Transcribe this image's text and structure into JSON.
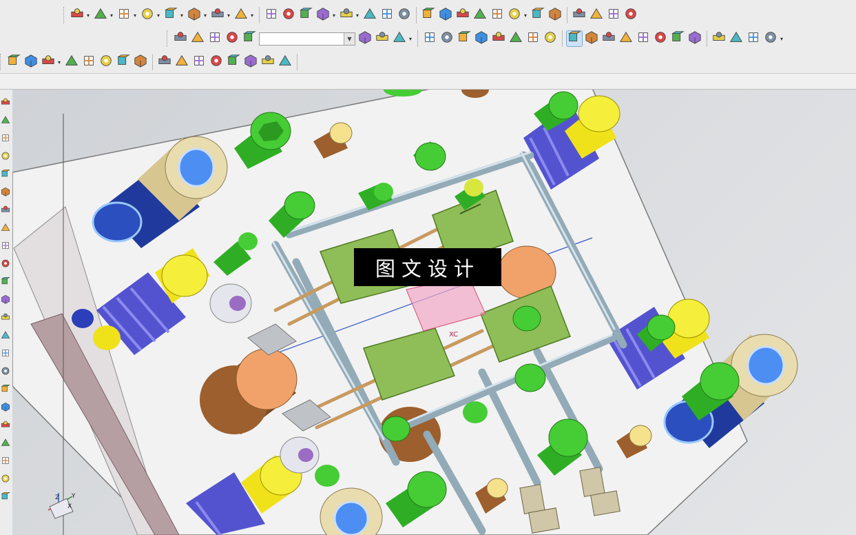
{
  "app": {
    "name": "3D CAD modeling application",
    "colors": {
      "toolbar_bg": "#ececec",
      "viewport_bg": "#d9dbde",
      "mold_plate": "#f4f4f4",
      "cooling_pipe": "#b9c9d4",
      "slider_block": "#8cba54",
      "bolt_head": "#3dbf2f",
      "spring": "#6261d6",
      "guide_pin": "#f2e51a",
      "bushing": "#d9c58f",
      "ejector_core": "#f1a26a"
    }
  },
  "toolbars": {
    "row1": [
      {
        "icon": "assembly-move-icon",
        "dropdown": true
      },
      {
        "icon": "component-edit-icon",
        "dropdown": true
      },
      {
        "icon": "component-delete-icon",
        "dropdown": true
      },
      {
        "icon": "component-copy-icon",
        "dropdown": true
      },
      {
        "icon": "component-pattern-icon",
        "dropdown": true
      },
      {
        "icon": "wave-link-icon",
        "dropdown": true
      },
      {
        "icon": "replace-component-icon",
        "dropdown": true
      },
      {
        "icon": "reference-set-icon",
        "dropdown": true
      },
      {
        "icon": "sketch-triangle-icon",
        "dropdown": false
      },
      {
        "icon": "table-grid-icon",
        "dropdown": false
      },
      {
        "icon": "datum-point-icon",
        "dropdown": false
      },
      {
        "icon": "gear-set-icon",
        "dropdown": true
      },
      {
        "icon": "rectangle-sketch-icon",
        "dropdown": true
      },
      {
        "icon": "extrude-block-icon",
        "dropdown": false
      },
      {
        "icon": "revolve-icon",
        "dropdown": false
      },
      {
        "icon": "box-icon",
        "dropdown": false
      },
      {
        "icon": "plate-icon",
        "dropdown": false
      },
      {
        "icon": "edge-blend-icon",
        "dropdown": false
      },
      {
        "icon": "measure-icon",
        "dropdown": false
      },
      {
        "icon": "waffle-plate-icon",
        "dropdown": false
      },
      {
        "icon": "connect-nodes-icon",
        "dropdown": false
      },
      {
        "icon": "teal-point-icon",
        "dropdown": true
      },
      {
        "icon": "cylinder-icon",
        "dropdown": false
      },
      {
        "icon": "prism-icon",
        "dropdown": false
      },
      {
        "icon": "orange-solid-icon",
        "dropdown": false
      },
      {
        "icon": "sheet-icon",
        "dropdown": false
      },
      {
        "icon": "cube-icon",
        "dropdown": false
      },
      {
        "icon": "multi-cube-icon",
        "dropdown": false
      }
    ],
    "row2": [
      {
        "icon": "mold-insert-icon",
        "dropdown": false
      },
      {
        "icon": "mold-slide-icon",
        "dropdown": false
      },
      {
        "icon": "pocket-icon",
        "dropdown": false
      },
      {
        "icon": "bottle-icon",
        "dropdown": false
      },
      {
        "icon": "trim-tool-icon",
        "dropdown": false
      },
      {
        "icon": "feature-box-icon",
        "dropdown": false
      },
      {
        "icon": "feature-cube-icon",
        "dropdown": false
      },
      {
        "icon": "curve-tool-icon",
        "dropdown": true
      },
      {
        "icon": "mold-wizard-initialize-icon",
        "dropdown": false
      },
      {
        "icon": "mold-csys-icon",
        "dropdown": false
      },
      {
        "icon": "shrinkage-icon",
        "dropdown": false
      },
      {
        "icon": "workpiece-icon",
        "dropdown": false
      },
      {
        "icon": "cavity-layout-icon",
        "dropdown": false
      },
      {
        "icon": "family-mold-icon",
        "dropdown": false
      },
      {
        "icon": "injection-gate-icon",
        "dropdown": false
      },
      {
        "icon": "runner-icon",
        "dropdown": false
      },
      {
        "icon": "mold-tools-icon",
        "dropdown": false,
        "selected": true
      },
      {
        "icon": "parting-icon",
        "dropdown": false
      },
      {
        "icon": "moldbase-icon",
        "dropdown": false
      },
      {
        "icon": "standard-part-icon",
        "dropdown": false
      },
      {
        "icon": "ejector-pin-icon",
        "dropdown": false
      },
      {
        "icon": "slider-lifter-icon",
        "dropdown": false
      },
      {
        "icon": "sub-insert-icon",
        "dropdown": false
      },
      {
        "icon": "cooling-icon",
        "dropdown": false
      },
      {
        "icon": "electrode-icon",
        "dropdown": false
      },
      {
        "icon": "trim-mold-icon",
        "dropdown": false
      },
      {
        "icon": "pocket-mold-icon",
        "dropdown": false
      },
      {
        "icon": "bom-icon",
        "dropdown": true
      }
    ],
    "row2_select_value": "",
    "row3": [
      {
        "icon": "snap-arrow-icon",
        "dropdown": false
      },
      {
        "icon": "snap-point-icon",
        "dropdown": false
      },
      {
        "icon": "filter-rect-icon",
        "dropdown": true
      },
      {
        "icon": "shaded-icon",
        "dropdown": false
      },
      {
        "icon": "shaded-edges-icon",
        "dropdown": false
      },
      {
        "icon": "end-point-icon",
        "dropdown": false
      },
      {
        "icon": "mid-point-icon",
        "dropdown": false
      },
      {
        "icon": "control-point-icon",
        "dropdown": false
      },
      {
        "icon": "intersection-icon",
        "dropdown": false
      },
      {
        "icon": "arc-center-icon",
        "dropdown": false
      },
      {
        "icon": "quadrant-icon",
        "dropdown": false
      },
      {
        "icon": "circle-point-icon",
        "dropdown": false
      },
      {
        "icon": "plus-point-icon",
        "dropdown": false
      },
      {
        "icon": "point-on-curve-icon",
        "dropdown": false
      },
      {
        "icon": "point-on-face-icon",
        "dropdown": false
      },
      {
        "icon": "snap-grid-icon",
        "dropdown": false
      }
    ]
  },
  "viewport": {
    "watermark": "图文设计",
    "csys_labels": [
      "Z",
      "Y",
      "X"
    ],
    "datum_label": "XC"
  },
  "resource_bar": [
    "part-navigator-icon",
    "assembly-navigator-icon",
    "constraint-icon",
    "history-icon",
    "reuse-library-icon",
    "roles-icon",
    "web-browser-icon",
    "palette-icon",
    "system-materials-icon",
    "process-studio-icon",
    "check-mate-icon",
    "view-icon",
    "layer-icon",
    "analysis-icon",
    "measure-icon",
    "wizard-icon",
    "manufacturing-icon",
    "dimension-icon",
    "drafting-icon",
    "render-icon",
    "motion-icon",
    "knowledge-icon",
    "visual-icon"
  ]
}
